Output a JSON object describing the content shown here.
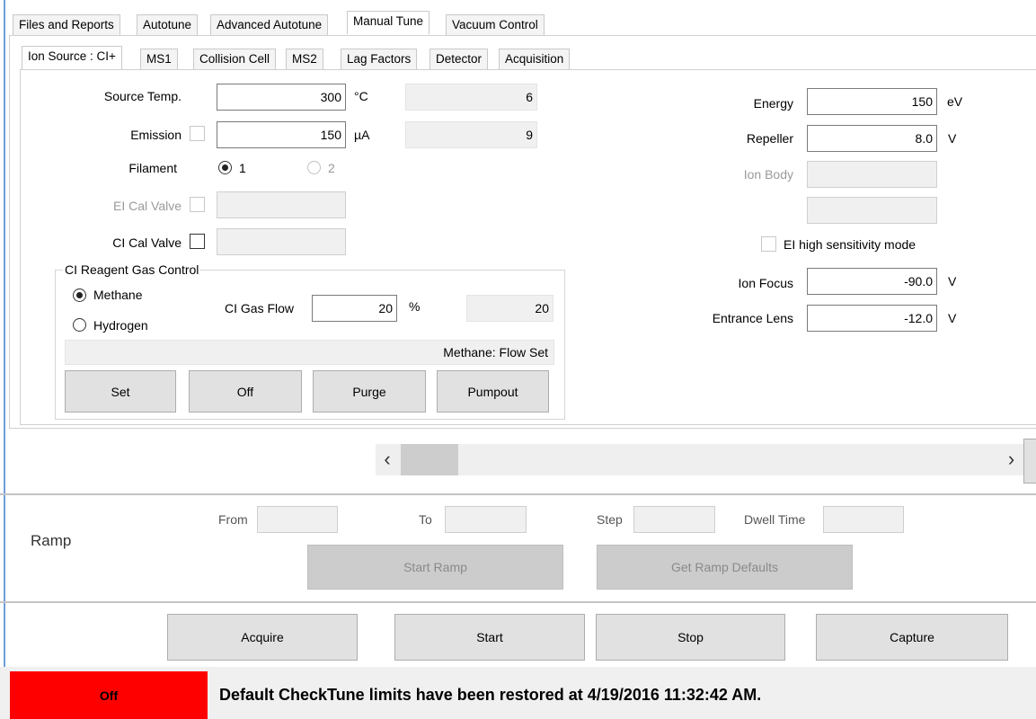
{
  "main_tabs": [
    "Files and Reports",
    "Autotune",
    "Advanced Autotune",
    "Manual Tune",
    "Vacuum Control"
  ],
  "sub_tabs": [
    "Ion Source : CI+",
    "MS1",
    "Collision Cell",
    "MS2",
    "Lag Factors",
    "Detector",
    "Acquisition"
  ],
  "source": {
    "source_temp_label": "Source Temp.",
    "source_temp_value": "300",
    "source_temp_unit": "°C",
    "source_temp_readback": "6",
    "emission_label": "Emission",
    "emission_value": "150",
    "emission_unit": "µA",
    "emission_readback": "9",
    "filament_label": "Filament",
    "filament_1": "1",
    "filament_2": "2",
    "ei_cal_valve_label": "EI Cal Valve",
    "ci_cal_valve_label": "CI Cal Valve"
  },
  "ci_gas": {
    "title": "CI Reagent Gas Control",
    "methane": "Methane",
    "hydrogen": "Hydrogen",
    "flow_label": "CI Gas Flow",
    "flow_value": "20",
    "flow_unit": "%",
    "flow_readback": "20",
    "status": "Methane: Flow Set",
    "set": "Set",
    "off": "Off",
    "purge": "Purge",
    "pumpout": "Pumpout"
  },
  "lenses": {
    "energy_label": "Energy",
    "energy_value": "150",
    "energy_unit": "eV",
    "repeller_label": "Repeller",
    "repeller_value": "8.0",
    "repeller_unit": "V",
    "ion_body_label": "Ion Body",
    "ei_high_sens": "EI high sensitivity mode",
    "ion_focus_label": "Ion Focus",
    "ion_focus_value": "-90.0",
    "ion_focus_unit": "V",
    "entrance_lens_label": "Entrance Lens",
    "entrance_lens_value": "-12.0",
    "entrance_lens_unit": "V"
  },
  "scroll": {
    "left": "‹",
    "right": "›"
  },
  "ramp": {
    "title": "Ramp",
    "from": "From",
    "to": "To",
    "step": "Step",
    "dwell": "Dwell Time",
    "start_ramp": "Start Ramp",
    "get_defaults": "Get Ramp Defaults"
  },
  "actions": {
    "acquire": "Acquire",
    "start": "Start",
    "stop": "Stop",
    "capture": "Capture"
  },
  "status": {
    "state": "Off",
    "state_color": "#ff0000",
    "message": "Default CheckTune limits have been restored at 4/19/2016 11:32:42 AM."
  }
}
